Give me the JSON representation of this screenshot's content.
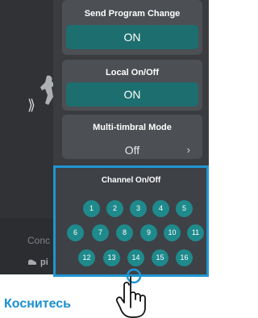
{
  "background": {
    "partial_text": "Conc",
    "piano_partial": "pi",
    "chevron": "⟫"
  },
  "settings": {
    "program_change": {
      "label": "Send Program Change",
      "value": "ON"
    },
    "local": {
      "label": "Local On/Off",
      "value": "ON"
    },
    "multitimbral": {
      "label": "Multi-timbral Mode",
      "value": "Off",
      "chevron": "›"
    }
  },
  "channel_popup": {
    "title": "Channel On/Off",
    "rows": [
      [
        "1",
        "2",
        "3",
        "4",
        "5"
      ],
      [
        "6",
        "7",
        "8",
        "9",
        "10",
        "11"
      ],
      [
        "12",
        "13",
        "14",
        "15",
        "16"
      ]
    ]
  },
  "touch_label": "Коснитесь",
  "colors": {
    "accent_blue": "#1f96d1",
    "teal_value": "#1d6e6f",
    "teal_circle": "#1f8a8c",
    "caption_blue": "#1a8fd1"
  },
  "icons": [
    "hand-tap-icon",
    "piano-icon",
    "double-chevron-icon"
  ]
}
